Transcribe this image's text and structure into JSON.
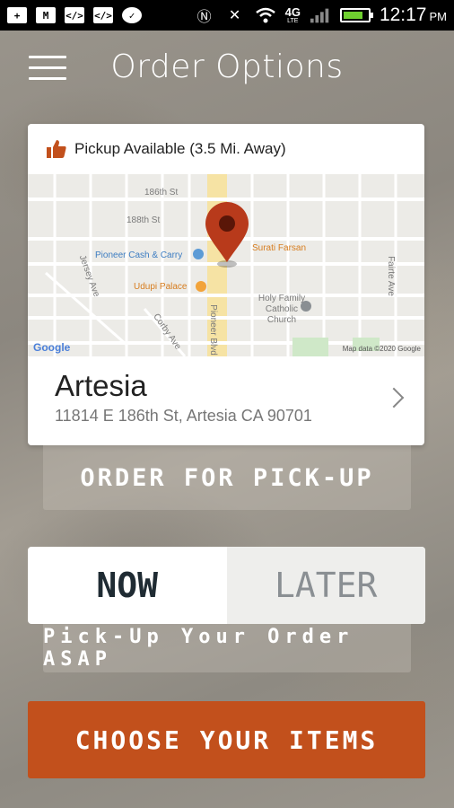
{
  "status_bar": {
    "time": "12:17",
    "ampm": "PM",
    "network": "4G",
    "network_sub": "LTE",
    "icons": [
      "plus-icon",
      "gmail-icon",
      "code-icon",
      "code-icon",
      "messenger-icon",
      "nfc-icon",
      "bluetooth-off-icon",
      "wifi-icon",
      "signal-icon",
      "battery-icon"
    ]
  },
  "header": {
    "title": "Order Options",
    "menu_icon": "hamburger-menu-icon"
  },
  "store": {
    "pickup_text": "Pickup Available (3.5 Mi. Away)",
    "pickup_icon": "thumbs-up-icon",
    "name": "Artesia",
    "address": "11814 E 186th St, Artesia CA 90701",
    "map": {
      "places": [
        "Pioneer Cash & Carry",
        "Udupi Palace",
        "Surati Farsan",
        "Holy Family Catholic Church"
      ],
      "streets": [
        "186th St",
        "188th St",
        "Jersey Ave",
        "Corby Ave",
        "Pioneer Blvd",
        "Fairte Ave"
      ],
      "attribution": "Map data ©2020 Google",
      "logo": "Google",
      "pin_color": "#b83a1b"
    }
  },
  "order_pickup_label": "ORDER FOR PICK-UP",
  "timing": {
    "now": "NOW",
    "later": "LATER",
    "selected": "NOW",
    "note": "Pick-Up Your Order ASAP"
  },
  "cta": {
    "label": "CHOOSE YOUR ITEMS",
    "color": "#c2501c"
  }
}
